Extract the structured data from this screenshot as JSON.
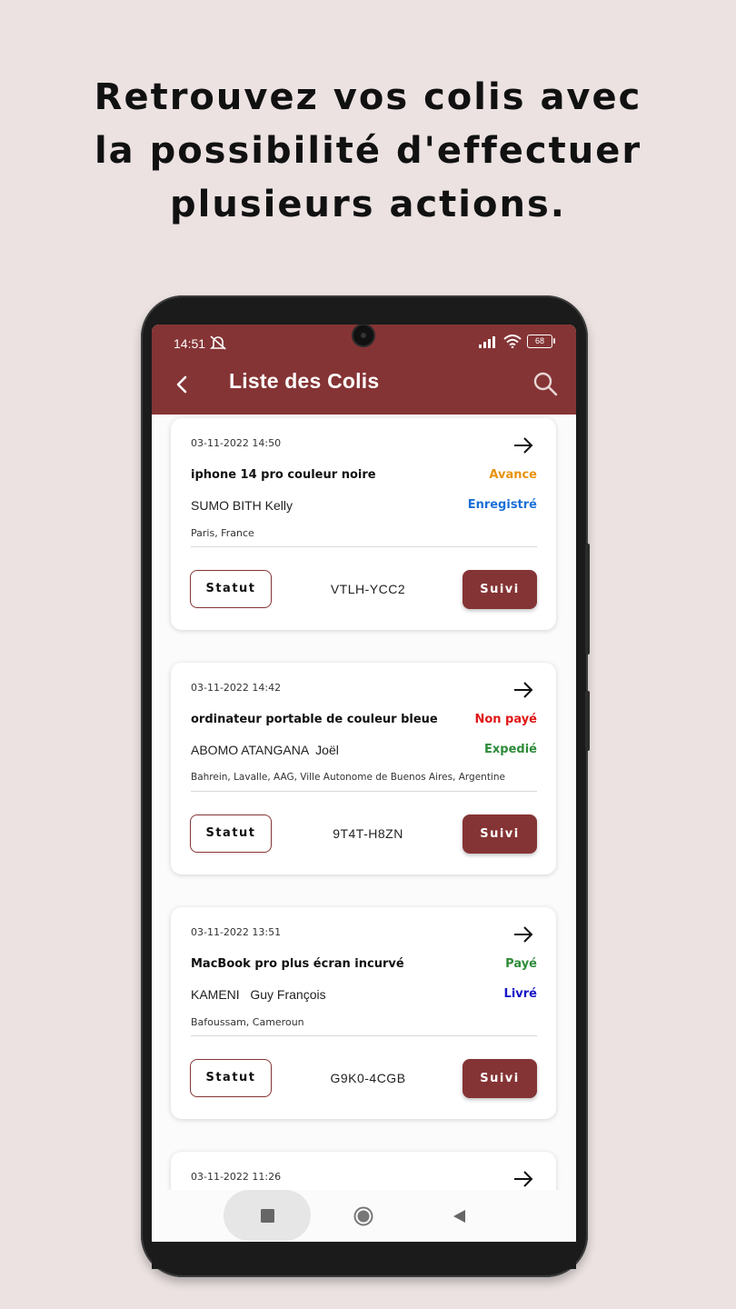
{
  "headline": {
    "line1": "Retrouvez vos colis avec",
    "line2": "la possibilité d'effectuer",
    "line3": "plusieurs actions."
  },
  "status_bar": {
    "time": "14:51",
    "battery": "68"
  },
  "appbar": {
    "title": "Liste des Colis",
    "back_icon": "chevron-left-icon",
    "search_icon": "search-icon"
  },
  "colors": {
    "brand": "#853435",
    "background": "#ece2e2",
    "avance": "#e8920f",
    "enregistre": "#1a6fd6",
    "non_paye": "#e01616",
    "expedie": "#2e8b3a",
    "paye": "#2e8b3a",
    "livre": "#1515c8"
  },
  "buttons": {
    "statut": "Statut",
    "suivi": "Suivi"
  },
  "parcels": [
    {
      "date": "03-11-2022 14:50",
      "product": "iphone 14 pro couleur noire",
      "payment": "Avance",
      "recipient": "SUMO BITH Kelly",
      "status": "Enregistré",
      "address": "Paris, France",
      "code": "VTLH-YCC2"
    },
    {
      "date": "03-11-2022 14:42",
      "product": "ordinateur portable de couleur bleue",
      "payment": "Non payé",
      "recipient": "ABOMO ATANGANA  Joël",
      "status": "Expedié",
      "address": "Bahrein, Lavalle, AAG, Ville Autonome de Buenos Aires, Argentine",
      "code": "9T4T-H8ZN"
    },
    {
      "date": "03-11-2022 13:51",
      "product": "MacBook pro plus écran incurvé",
      "payment": "Payé",
      "recipient": "KAMENI   Guy François",
      "status": "Livré",
      "address": "Bafoussam, Cameroun",
      "code": "G9K0-4CGB"
    },
    {
      "date": "03-11-2022 11:26"
    }
  ]
}
